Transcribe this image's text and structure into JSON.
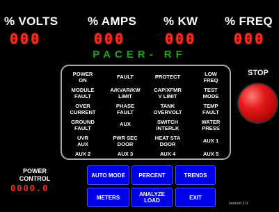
{
  "header": {
    "titles": [
      "% VOLTS",
      "% AMPS",
      "% KW",
      "% FREQ"
    ],
    "readouts": [
      "000",
      "000",
      "000",
      "000"
    ]
  },
  "brand": "PACER- RF",
  "fault_panel": {
    "items": [
      "POWER\nON",
      "FAULT",
      "PROTECT",
      "LOW\nFREQ",
      "MODULE\nFAULT",
      "A/KVAR/KW\nLIMIT",
      "CAP/XFMR\nV LIMIT",
      "TEST\nMODE",
      "OVER\nCURRENT",
      "PHASE\nFAULT",
      "TANK\nOVERVOLT",
      "TEMP\nFAULT",
      "GROUND\nFAULT",
      "AUX",
      "SWITCH\nINTERLK",
      "WATER\nPRESS",
      "UVR\nAUX",
      "PWR SEC\nDOOR",
      "HEAT STA\nDOOR",
      "AUX 1",
      "AUX 2",
      "AUX 3",
      "AUX 4",
      "AUX 5"
    ]
  },
  "stop": {
    "label": "STOP"
  },
  "power_control": {
    "label": "POWER\nCONTROL",
    "value": "0000.0"
  },
  "buttons": {
    "auto_mode": "AUTO MODE",
    "percent": "PERCENT",
    "trends": "TRENDS",
    "meters": "METERS",
    "analyze_load": "ANALYZE\nLOAD",
    "exit": "EXIT"
  },
  "version": "version 2.0",
  "colors": {
    "readout": "#ff2a1a",
    "brand": "#18a818",
    "button": "#0000e8",
    "stop": "#e41a1a"
  }
}
